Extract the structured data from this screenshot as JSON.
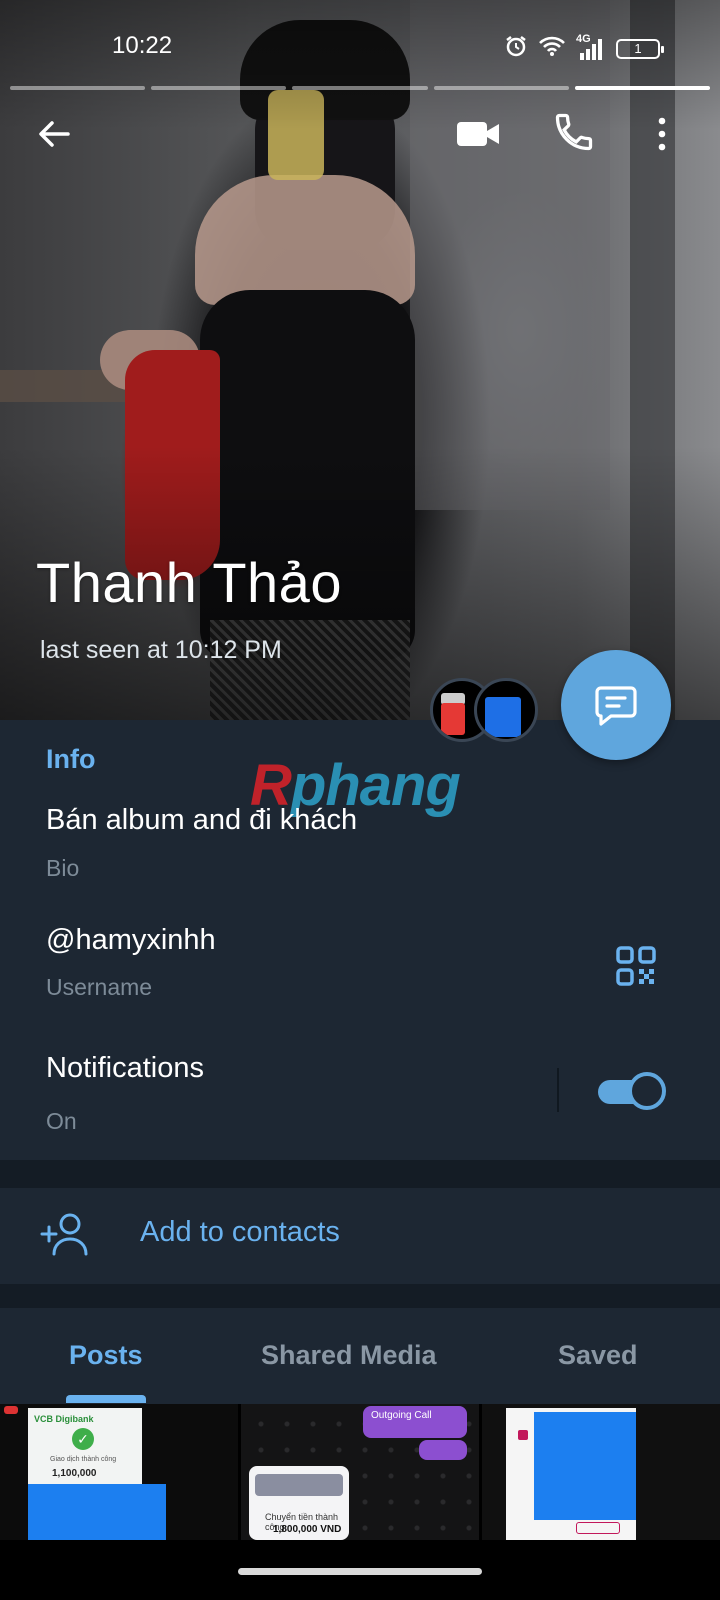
{
  "status_bar": {
    "time": "10:22",
    "network": "4G",
    "battery": "1"
  },
  "story_progress": {
    "segments": 5,
    "active_index": 4
  },
  "header": {
    "icons": [
      "back-arrow-icon",
      "video-call-icon",
      "phone-icon",
      "more-vertical-icon"
    ]
  },
  "profile": {
    "name": "Thanh Thảo",
    "last_seen": "last seen at 10:12 PM"
  },
  "watermark": {
    "part1": "R",
    "part2": "phang"
  },
  "info": {
    "heading": "Info",
    "bio": {
      "value": "Bán album and đi khách",
      "label": "Bio"
    },
    "username": {
      "value": "@hamyxinhh",
      "label": "Username"
    },
    "notifications": {
      "value": "Notifications",
      "label": "On",
      "enabled": true
    }
  },
  "actions": {
    "add_contacts": "Add to contacts"
  },
  "tabs": {
    "items": [
      {
        "label": "Posts",
        "active": true
      },
      {
        "label": "Shared Media",
        "active": false
      },
      {
        "label": "Saved",
        "active": false
      }
    ]
  },
  "posts_preview": {
    "post1": {
      "brand": "VCB Digibank",
      "title": "Giao dịch thành công",
      "amount": "1,100,000"
    },
    "post2": {
      "bubble": "Outgoing Call",
      "sheet_title": "Chuyển tiền thành công",
      "amount": "1,800,000 VND"
    },
    "post3": {}
  },
  "colors": {
    "background": "#1d2733",
    "accent": "#6ab2ef",
    "fab": "#5fa6dd",
    "separator": "#141c25"
  }
}
